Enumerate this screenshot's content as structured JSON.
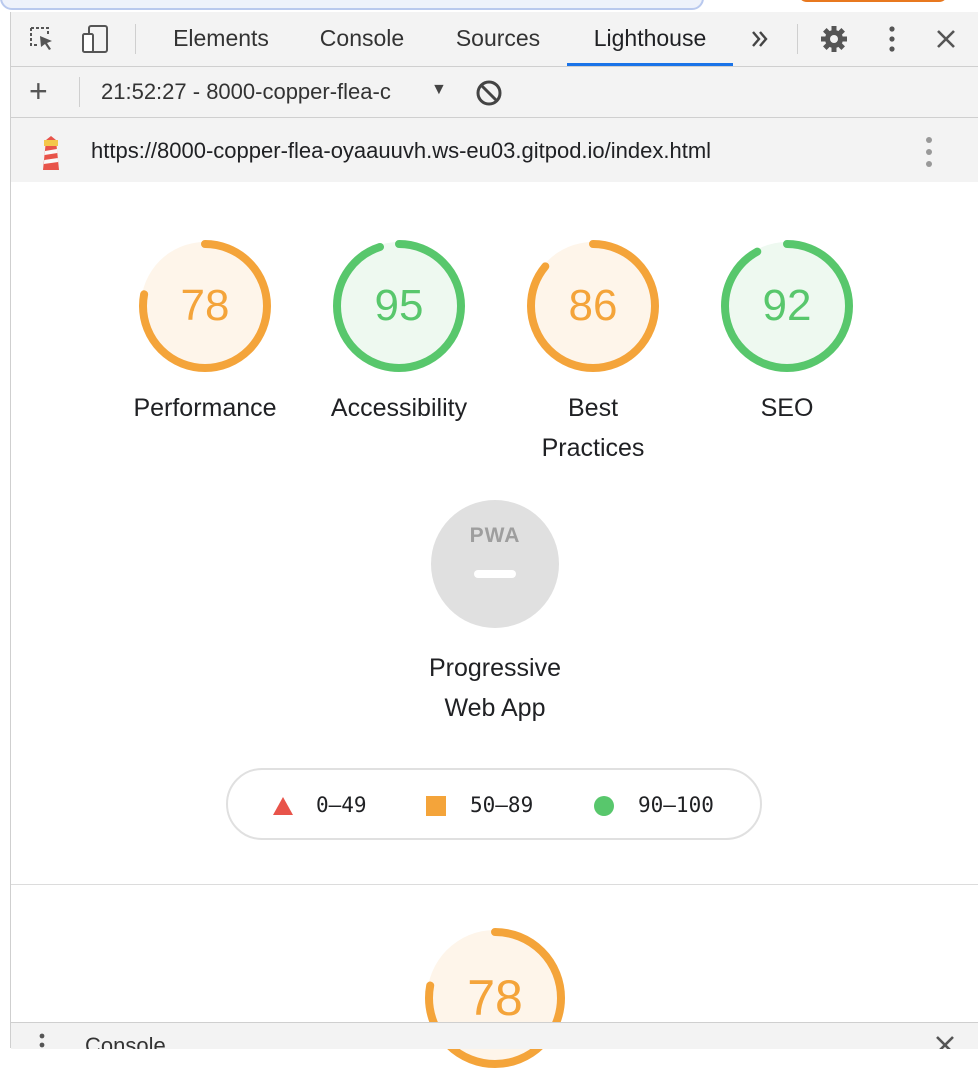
{
  "devtools": {
    "tabs": [
      {
        "label": "Elements"
      },
      {
        "label": "Console"
      },
      {
        "label": "Sources"
      },
      {
        "label": "Lighthouse",
        "active": true
      }
    ],
    "overflow_icon": "chevron-double-right-icon",
    "settings_icon": "gear-icon",
    "menu_icon": "kebab-icon",
    "close_icon": "close-icon"
  },
  "report_toolbar": {
    "report_selector": "21:52:27 - 8000-copper-flea-c",
    "add_icon": "plus-icon",
    "clear_icon": "block-icon"
  },
  "report_header": {
    "url": "https://8000-copper-flea-oyaauuvh.ws-eu03.gitpod.io/index.html",
    "logo_icon": "lighthouse-icon"
  },
  "scores": [
    {
      "label_lines": [
        "Performance"
      ],
      "score": "78",
      "color": "#f4a43a",
      "bg": "#fef5ea"
    },
    {
      "label_lines": [
        "Accessibility"
      ],
      "score": "95",
      "color": "#58c76c",
      "bg": "#eef9f0"
    },
    {
      "label_lines": [
        "Best",
        "Practices"
      ],
      "score": "86",
      "color": "#f4a43a",
      "bg": "#fef5ea"
    },
    {
      "label_lines": [
        "SEO"
      ],
      "score": "92",
      "color": "#58c76c",
      "bg": "#eef9f0"
    }
  ],
  "pwa": {
    "badge": "PWA",
    "label_lines": [
      "Progressive",
      "Web App"
    ]
  },
  "legend": [
    {
      "range": "0–49",
      "shape": "triangle",
      "color": "#e8544a"
    },
    {
      "range": "50–89",
      "shape": "square",
      "color": "#f4a43a"
    },
    {
      "range": "90–100",
      "shape": "circle",
      "color": "#58c76c"
    }
  ],
  "performance_section": {
    "score": "78",
    "color": "#f4a43a"
  },
  "drawer": {
    "label": "Console"
  }
}
